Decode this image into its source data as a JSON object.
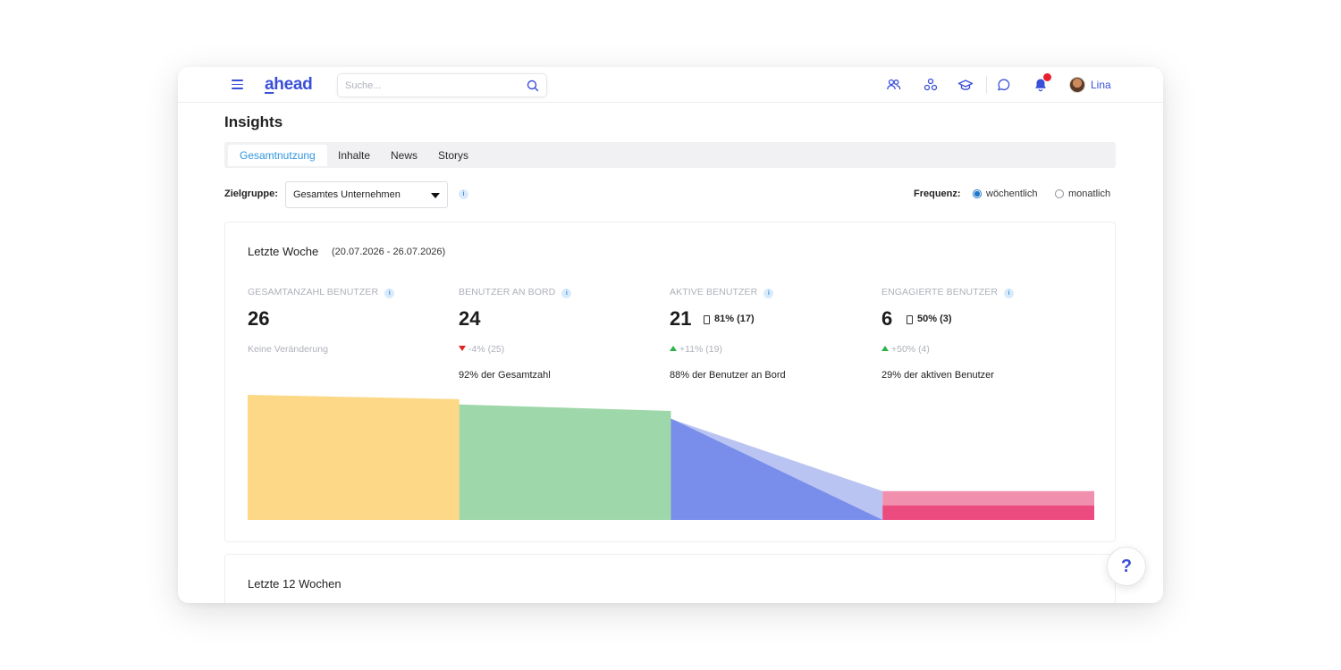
{
  "app": {
    "logo": "ahead",
    "logo_first": "a",
    "logo_rest": "head"
  },
  "search": {
    "placeholder": "Suche..."
  },
  "user": {
    "name": "Lina"
  },
  "icons": [
    "menu-icon",
    "search-icon",
    "users-icon",
    "groups-icon",
    "graduation-cap-icon",
    "chat-icon",
    "bell-icon",
    "avatar"
  ],
  "page": {
    "title": "Insights"
  },
  "tabs": [
    {
      "label": "Gesamtnutzung",
      "active": true
    },
    {
      "label": "Inhalte",
      "active": false
    },
    {
      "label": "News",
      "active": false
    },
    {
      "label": "Storys",
      "active": false
    }
  ],
  "filter": {
    "label": "Zielgruppe:",
    "selected": "Gesamtes Unternehmen",
    "info": "i"
  },
  "frequency": {
    "label": "Frequenz:",
    "options": [
      {
        "label": "wöchentlich",
        "selected": true
      },
      {
        "label": "monatlich",
        "selected": false
      }
    ]
  },
  "week_card": {
    "title": "Letzte Woche",
    "range": "(20.07.2026 - 26.07.2026)",
    "kpis": [
      {
        "label": "GESAMTANZAHL BENUTZER",
        "value": "26",
        "pct": "",
        "change": "Keine Veränderung",
        "trend": "none",
        "note": ""
      },
      {
        "label": "BENUTZER AN BORD",
        "value": "24",
        "pct": "",
        "change": "-4% (25)",
        "trend": "down",
        "note": "92% der Gesamtzahl"
      },
      {
        "label": "AKTIVE BENUTZER",
        "value": "21",
        "pct": "81% (17)",
        "change": "+11% (19)",
        "trend": "up",
        "note": "88% der Benutzer an Bord"
      },
      {
        "label": "ENGAGIERTE BENUTZER",
        "value": "6",
        "pct": "50% (3)",
        "change": "+50% (4)",
        "trend": "up",
        "note": "29% der aktiven Benutzer"
      }
    ]
  },
  "colors": {
    "accent": "#3a4fd8",
    "tab_active": "#2f96e0",
    "funnel_total": "#fcd887",
    "funnel_onboard": "#9ed7a9",
    "funnel_active_light": "#bac4f2",
    "funnel_active": "#788eea",
    "funnel_engaged_light": "#f08fae",
    "funnel_engaged": "#ec4b80",
    "trend_up": "#2bb34a",
    "trend_down": "#e02424"
  },
  "chart_data": {
    "type": "area",
    "categories": [
      "GESAMTANZAHL BENUTZER",
      "BENUTZER AN BORD",
      "AKTIVE BENUTZER",
      "ENGAGIERTE BENUTZER"
    ],
    "values": [
      26,
      24,
      21,
      6
    ],
    "sub_values": [
      null,
      null,
      17,
      3
    ],
    "ylim": [
      0,
      26
    ]
  },
  "trend_card": {
    "title": "Letzte 12 Wochen"
  },
  "help": {
    "label": "?"
  }
}
